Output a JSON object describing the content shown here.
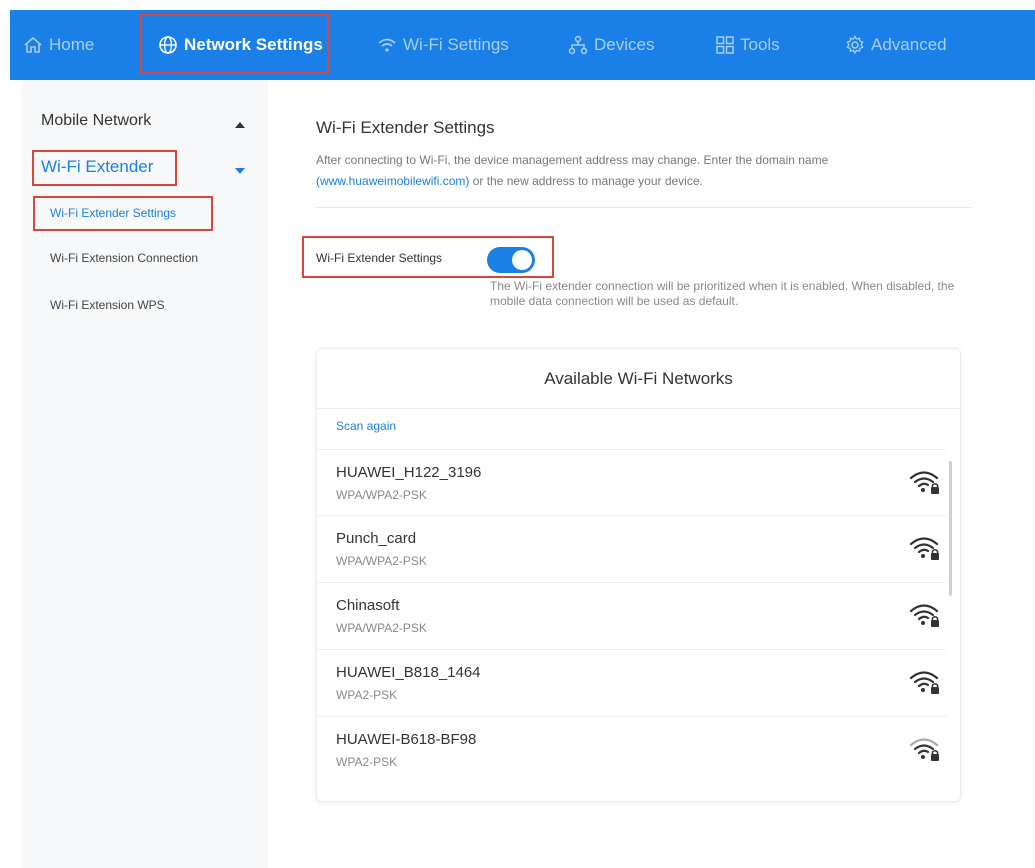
{
  "nav": {
    "home": "Home",
    "network_settings": "Network Settings",
    "wifi_settings": "Wi-Fi Settings",
    "devices": "Devices",
    "tools": "Tools",
    "advanced": "Advanced"
  },
  "sidebar": {
    "mobile_network": "Mobile Network",
    "wifi_extender": "Wi-Fi Extender",
    "items": [
      "Wi-Fi Extender Settings",
      "Wi-Fi Extension Connection",
      "Wi-Fi Extension WPS"
    ]
  },
  "main": {
    "title": "Wi-Fi Extender Settings",
    "desc_before": "After connecting to Wi-Fi, the device management address may change. Enter the domain name",
    "desc_link": "(www.huaweimobilewifi.com)",
    "desc_after": " or the new address to manage your device.",
    "toggle_label": "Wi-Fi Extender Settings",
    "toggle_enabled": true,
    "toggle_note": "The Wi-Fi extender connection will be prioritized when it is enabled. When disabled, the mobile data connection will be used as default."
  },
  "networks": {
    "title": "Available Wi-Fi Networks",
    "scan_again": "Scan again",
    "list": [
      {
        "name": "HUAWEI_H122_3196",
        "security": "WPA/WPA2-PSK",
        "icon": "wifi-locked-icon"
      },
      {
        "name": "Punch_card",
        "security": "WPA/WPA2-PSK",
        "icon": "wifi-locked-icon"
      },
      {
        "name": "Chinasoft",
        "security": "WPA/WPA2-PSK",
        "icon": "wifi-locked-icon"
      },
      {
        "name": "HUAWEI_B818_1464",
        "security": "WPA2-PSK",
        "icon": "wifi-locked-icon"
      },
      {
        "name": "HUAWEI-B618-BF98",
        "security": "WPA2-PSK",
        "icon": "wifi-locked-icon"
      }
    ]
  },
  "colors": {
    "accent": "#1a7fe6",
    "highlight_box": "#d9463f"
  }
}
